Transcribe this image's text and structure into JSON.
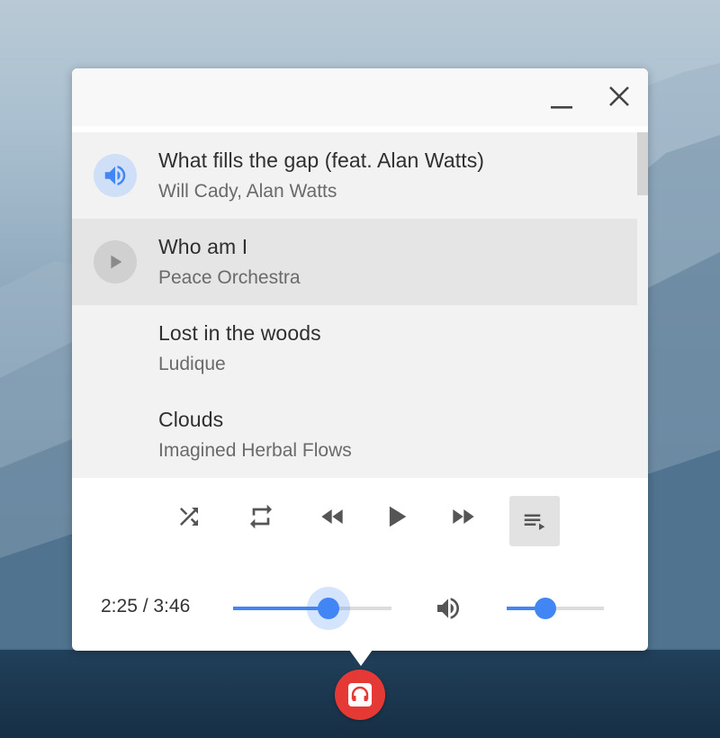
{
  "window": {
    "minimize_icon": "minimize-icon",
    "close_icon": "close-icon"
  },
  "playlist": {
    "tracks": [
      {
        "title": "What fills the gap (feat. Alan Watts)",
        "artist": "Will Cady, Alan Watts",
        "state": "playing",
        "icon": "volume-icon"
      },
      {
        "title": "Who am I",
        "artist": "Peace Orchestra",
        "state": "hovered",
        "icon": "play-icon"
      },
      {
        "title": "Lost in the woods",
        "artist": "Ludique",
        "state": "idle"
      },
      {
        "title": "Clouds",
        "artist": "Imagined Herbal Flows",
        "state": "idle"
      }
    ]
  },
  "controls": {
    "shuffle": "shuffle-icon",
    "repeat": "repeat-icon",
    "rewind": "rewind-icon",
    "play": "play-icon",
    "fast_forward": "fast-forward-icon",
    "playlist": "playlist-icon",
    "playlist_active": true
  },
  "progress": {
    "time_text": "2:25 / 3:46",
    "fraction": 0.6
  },
  "volume": {
    "icon": "volume-icon",
    "fraction": 0.4
  },
  "colors": {
    "accent": "#4285f4",
    "tray_button": "#e53935"
  },
  "tray": {
    "icon": "headphones-icon"
  }
}
